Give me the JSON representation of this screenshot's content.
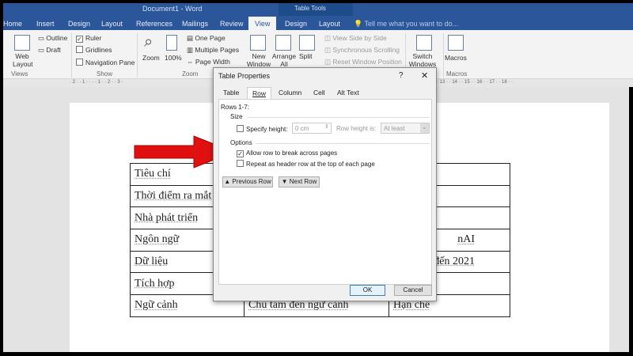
{
  "window": {
    "title": "Document1 - Word",
    "context_title": "Table Tools"
  },
  "tabs": [
    "Home",
    "Insert",
    "Design",
    "Layout",
    "References",
    "Mailings",
    "Review",
    "View",
    "Design",
    "Layout"
  ],
  "tell_me": "Tell me what you want to do...",
  "ribbon": {
    "views": {
      "label": "Views",
      "web_layout": "Web Layout",
      "outline": "Outline",
      "draft": "Draft"
    },
    "show": {
      "label": "Show",
      "ruler": "Ruler",
      "gridlines": "Gridlines",
      "navigation_pane": "Navigation Pane"
    },
    "zoom": {
      "label": "Zoom",
      "zoom": "Zoom",
      "hundred": "100%",
      "one_page": "One Page",
      "multiple_pages": "Multiple Pages",
      "page_width": "Page Width"
    },
    "window": {
      "new_window": "New Window",
      "arrange_all": "Arrange All",
      "split": "Split",
      "side_by_side": "View Side by Side",
      "sync_scroll": "Synchronous Scrolling",
      "reset_pos": "Reset Window Position",
      "switch_windows": "Switch Windows"
    },
    "macros": {
      "label": "Macros",
      "macros": "Macros"
    }
  },
  "ruler": "· 2 · · 1 · ·  · · 1 · · 2 · · 3 ·",
  "ruler_right": "· 13 · · 14 · · 15 · · 16 · · 17 · · 18 · ·",
  "dialog": {
    "title": "Table Properties",
    "help": "?",
    "close": "✕",
    "tabs": [
      "Table",
      "Row",
      "Column",
      "Cell",
      "Alt Text"
    ],
    "rows_label": "Rows 1-7:",
    "size_label": "Size",
    "specify_height": "Specify height:",
    "height_value": "0 cm",
    "row_height_is": "Row height is:",
    "at_least": "At least",
    "options_label": "Options",
    "allow_break": "Allow row to break across pages",
    "allow_break_checked": true,
    "repeat_header": "Repeat as header row at the top of each page",
    "repeat_header_checked": false,
    "previous_row": "Previous Row",
    "next_row": "Next Row",
    "ok": "OK",
    "cancel": "Cancel"
  },
  "table": [
    [
      "Tiêu chí",
      "",
      ""
    ],
    [
      "Thời điểm ra mắt",
      "",
      ""
    ],
    [
      "Nhà phát triển",
      "",
      ""
    ],
    [
      "Ngôn ngữ",
      "",
      "nAI"
    ],
    [
      "Dữ liệu",
      "",
      "đến 2021"
    ],
    [
      "Tích hợp",
      "",
      ""
    ],
    [
      "Ngữ cảnh",
      "Chú tâm đến ngữ cảnh",
      "Hạn chế"
    ]
  ],
  "colors": {
    "brand": "#2b579a",
    "arrow": "#e01010"
  }
}
